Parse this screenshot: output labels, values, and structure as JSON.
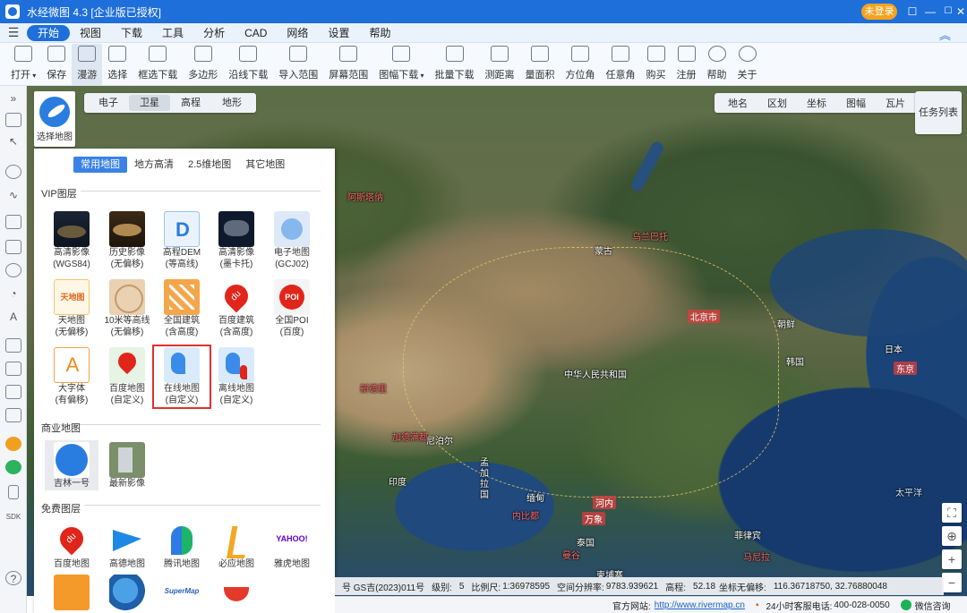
{
  "window": {
    "title": "水经微图 4.3 [企业版已授权]",
    "login_label": "未登录",
    "controls": [
      "☐",
      "—",
      "☐",
      "✕"
    ]
  },
  "menubar": {
    "items": [
      "开始",
      "视图",
      "下载",
      "工具",
      "分析",
      "CAD",
      "网络",
      "设置",
      "帮助"
    ],
    "active": "开始"
  },
  "toolbar": {
    "items": [
      {
        "label": "打开",
        "icon": "folder-icon",
        "dropdown": true
      },
      {
        "label": "保存",
        "icon": "save-icon"
      },
      {
        "label": "漫游",
        "icon": "hand-icon",
        "active": true
      },
      {
        "label": "选择",
        "icon": "cursor-icon"
      },
      {
        "label": "框选下载",
        "icon": "box-download-icon"
      },
      {
        "label": "多边形",
        "icon": "polygon-icon"
      },
      {
        "label": "沿线下载",
        "icon": "line-download-icon"
      },
      {
        "label": "导入范围",
        "icon": "import-icon"
      },
      {
        "label": "屏幕范围",
        "icon": "screen-icon"
      },
      {
        "label": "图幅下载",
        "icon": "sheet-icon",
        "dropdown": true
      },
      {
        "label": "批量下载",
        "icon": "batch-icon"
      },
      {
        "label": "测距离",
        "icon": "ruler-icon"
      },
      {
        "label": "量面积",
        "icon": "area-icon"
      },
      {
        "label": "方位角",
        "icon": "azimuth-icon"
      },
      {
        "label": "任意角",
        "icon": "angle-icon"
      },
      {
        "label": "购买",
        "icon": "cart-icon"
      },
      {
        "label": "注册",
        "icon": "register-icon"
      },
      {
        "label": "帮助",
        "icon": "help-icon"
      },
      {
        "label": "关于",
        "icon": "about-icon"
      }
    ]
  },
  "map_tabs": {
    "items": [
      "电子",
      "卫星",
      "高程",
      "地形"
    ],
    "selected": "卫星"
  },
  "layer_tabs": {
    "items": [
      "地名",
      "区划",
      "坐标",
      "图幅",
      "瓦片"
    ]
  },
  "task_list_label": "任务列表",
  "select_map_label": "选择地图",
  "panel": {
    "tabs": [
      "常用地图",
      "地方高清",
      "2.5维地图",
      "其它地图"
    ],
    "selected_tab": "常用地图",
    "vip_title": "VIP图层",
    "vip_tiles": [
      {
        "l1": "高清影像",
        "l2": "(WGS84)",
        "icon": "hd-image-icon"
      },
      {
        "l1": "历史影像",
        "l2": "(无偏移)",
        "icon": "history-image-icon"
      },
      {
        "l1": "高程DEM",
        "l2": "(等高线)",
        "icon": "dem-icon"
      },
      {
        "l1": "高清影像",
        "l2": "(墨卡托)",
        "icon": "mercator-image-icon"
      },
      {
        "l1": "电子地图",
        "l2": "(GCJ02)",
        "icon": "electronic-map-icon"
      },
      {
        "l1": "天地图",
        "l2": "(无偏移)",
        "icon": "tianditu-icon"
      },
      {
        "l1": "10米等高线",
        "l2": "(无偏移)",
        "icon": "contour-icon"
      },
      {
        "l1": "全国建筑",
        "l2": "(含高度)",
        "icon": "building-icon"
      },
      {
        "l1": "百度建筑",
        "l2": "(含高度)",
        "icon": "baidu-building-icon"
      },
      {
        "l1": "全国POI",
        "l2": "(百度)",
        "icon": "poi-icon"
      },
      {
        "l1": "大字体",
        "l2": "(有偏移)",
        "icon": "large-font-icon"
      },
      {
        "l1": "百度地图",
        "l2": "(自定义)",
        "icon": "baidu-custom-icon"
      },
      {
        "l1": "在线地图",
        "l2": "(自定义)",
        "icon": "online-map-icon",
        "selected": true
      },
      {
        "l1": "离线地图",
        "l2": "(自定义)",
        "icon": "offline-map-icon"
      }
    ],
    "commercial_title": "商业地图",
    "commercial_tiles": [
      {
        "l1": "吉林一号",
        "icon": "jilin-icon",
        "selected": true
      },
      {
        "l1": "最新影像",
        "icon": "latest-image-icon"
      }
    ],
    "free_title": "免费图层",
    "free_tiles": [
      {
        "l1": "百度地图",
        "icon": "baidu-icon"
      },
      {
        "l1": "高德地图",
        "icon": "gaode-icon"
      },
      {
        "l1": "腾讯地图",
        "icon": "tencent-icon"
      },
      {
        "l1": "必应地图",
        "icon": "bing-icon"
      },
      {
        "l1": "雅虎地图",
        "icon": "yahoo-icon"
      },
      {
        "l1": "",
        "icon": "orange-map-icon"
      },
      {
        "l1": "",
        "icon": "globe-icon"
      },
      {
        "l1": "",
        "icon": "supermap-icon"
      },
      {
        "l1": "",
        "icon": "boat-icon"
      }
    ]
  },
  "map_labels": [
    {
      "text": "蒙古",
      "style": ""
    },
    {
      "text": "乌兰巴托",
      "style": "red"
    },
    {
      "text": "中华人民共和国",
      "style": ""
    },
    {
      "text": "北京市",
      "style": "pill"
    },
    {
      "text": "朝鲜",
      "style": ""
    },
    {
      "text": "韩国",
      "style": ""
    },
    {
      "text": "日本",
      "style": ""
    },
    {
      "text": "东京",
      "style": "pill"
    },
    {
      "text": "阿斯塔纳",
      "style": "red"
    },
    {
      "text": "新德里",
      "style": "red"
    },
    {
      "text": "尼泊尔",
      "style": ""
    },
    {
      "text": "加德满都",
      "style": "red"
    },
    {
      "text": "印度",
      "style": ""
    },
    {
      "text": "孟加拉国",
      "style": ""
    },
    {
      "text": "缅甸",
      "style": ""
    },
    {
      "text": "内比都",
      "style": "red"
    },
    {
      "text": "河内",
      "style": "pill"
    },
    {
      "text": "万象",
      "style": "pill"
    },
    {
      "text": "泰国",
      "style": ""
    },
    {
      "text": "曼谷",
      "style": "red"
    },
    {
      "text": "柬埔寨",
      "style": ""
    },
    {
      "text": "菲律宾",
      "style": ""
    },
    {
      "text": "马尼拉",
      "style": "red"
    },
    {
      "text": "太平洋",
      "style": "blue"
    }
  ],
  "status": {
    "gs_label": "号 GS吉(2023)011号",
    "level_label": "级别:",
    "level_value": "5",
    "scale_label": "比例尺:",
    "scale_value": "1:36978595",
    "resolution_label": "空间分辨率:",
    "resolution_value": "9783.939621",
    "elevation_label": "高程:",
    "elevation_value": "52.18",
    "coord_label": "坐标无偏移:",
    "coord_value": "116.36718750, 32.76880048"
  },
  "bottom": {
    "site_label": "官方网站:",
    "site_url": "http://www.rivermap.cn",
    "phone_label": "24小时客服电话:",
    "phone": "400-028-0050",
    "wechat_label": "微信咨询"
  },
  "colors": {
    "accent": "#1e6fd9",
    "login": "#f4a21d",
    "selected_outline": "#e03030"
  }
}
